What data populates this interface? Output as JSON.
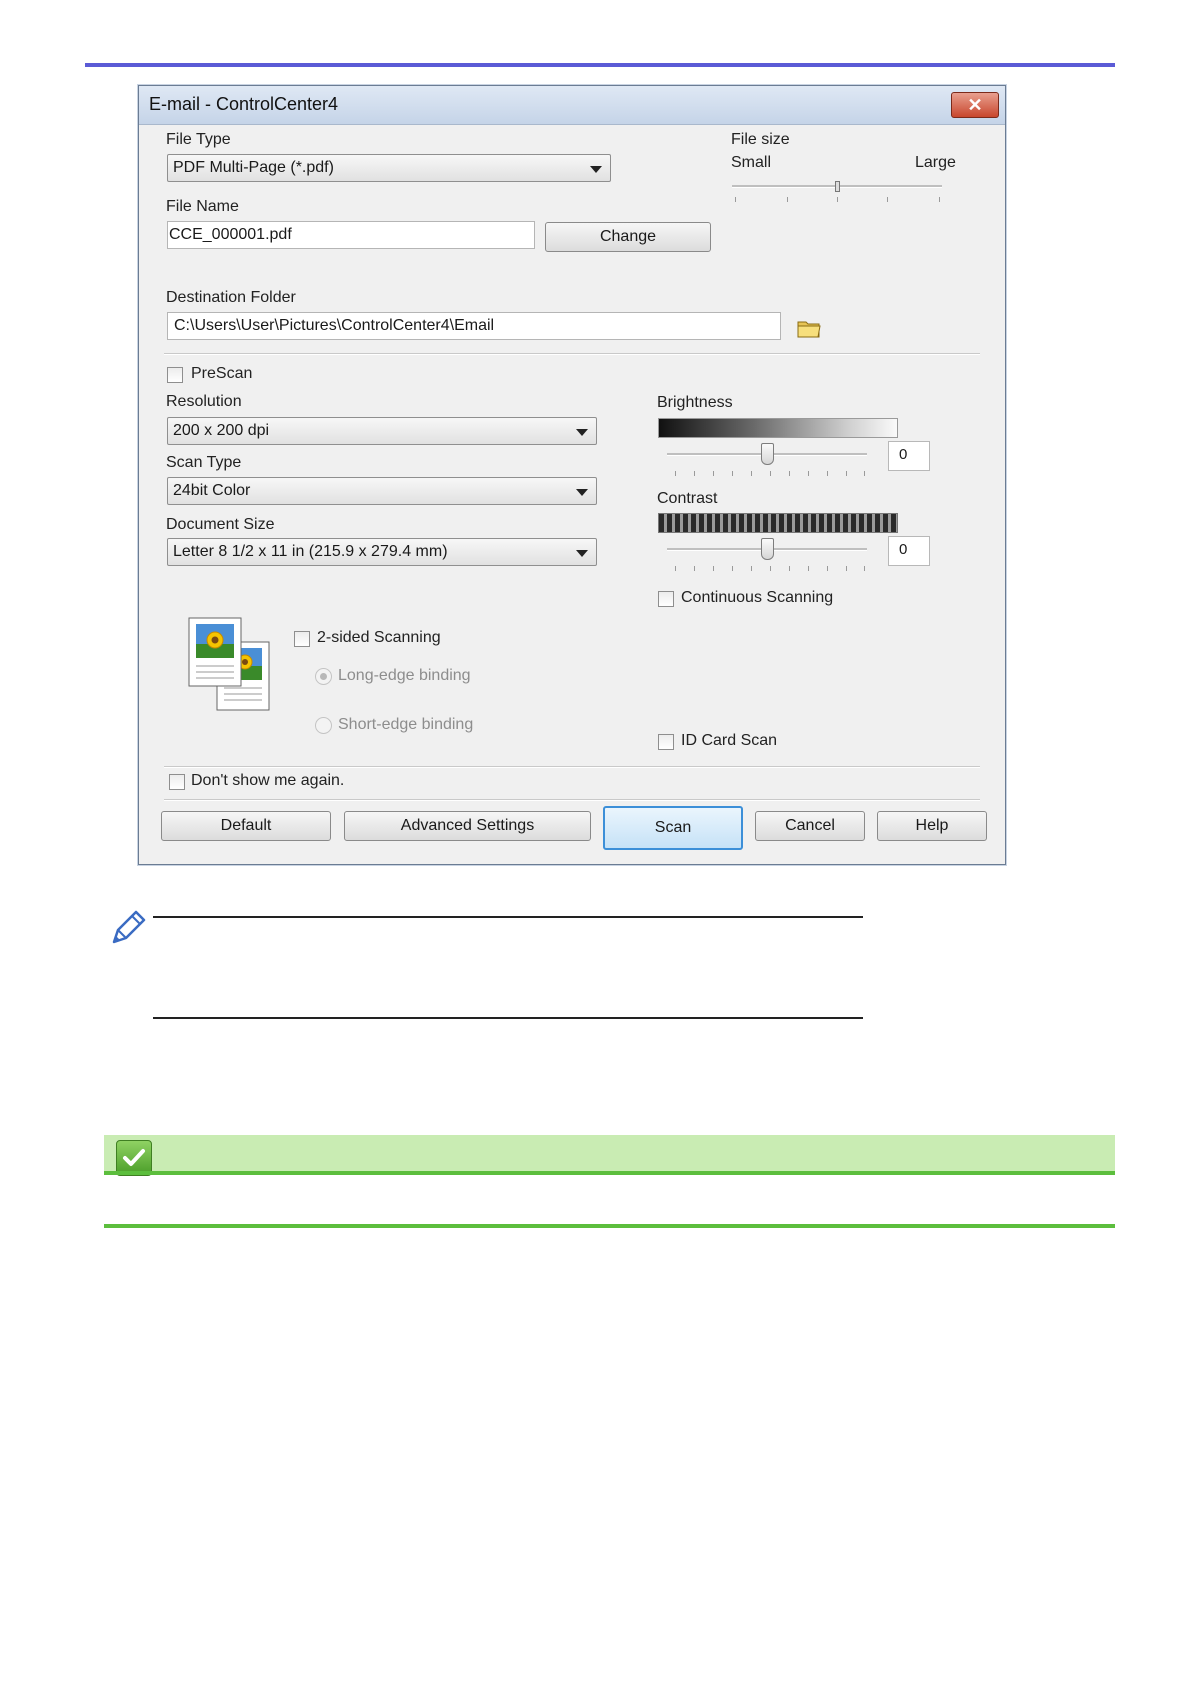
{
  "dialog": {
    "title": "E-mail - ControlCenter4",
    "close_glyph": "✕",
    "file_type_label": "File Type",
    "file_type_value": "PDF Multi-Page (*.pdf)",
    "file_size_label": "File size",
    "file_size_small": "Small",
    "file_size_large": "Large",
    "file_size_level": 0.5,
    "file_name_label": "File Name",
    "file_name_value": "CCE_000001.pdf",
    "change_button": "Change",
    "destination_label": "Destination Folder",
    "destination_value": "C:\\Users\\User\\Pictures\\ControlCenter4\\Email",
    "folder_icon": "folder-icon",
    "prescan_label": "PreScan",
    "resolution_label": "Resolution",
    "resolution_value": "200 x 200 dpi",
    "scan_type_label": "Scan Type",
    "scan_type_value": "24bit Color",
    "document_size_label": "Document Size",
    "document_size_value": "Letter 8 1/2 x 11 in (215.9 x 279.4 mm)",
    "brightness_label": "Brightness",
    "brightness_value": "0",
    "contrast_label": "Contrast",
    "contrast_value": "0",
    "continuous_label": "Continuous Scanning",
    "two_sided_label": "2-sided Scanning",
    "long_edge_label": "Long-edge binding",
    "short_edge_label": "Short-edge binding",
    "id_card_label": "ID Card Scan",
    "dont_show_label": "Don't show me again.",
    "buttons": {
      "default": "Default",
      "advanced": "Advanced Settings",
      "scan": "Scan",
      "cancel": "Cancel",
      "help": "Help"
    }
  },
  "note_icon": "pencil-icon",
  "related_icon": "checkmark-icon",
  "colors": {
    "top_rule": "#5b5bd6",
    "green_band": "#c9ecb3",
    "green_rule": "#5cbe3d"
  }
}
